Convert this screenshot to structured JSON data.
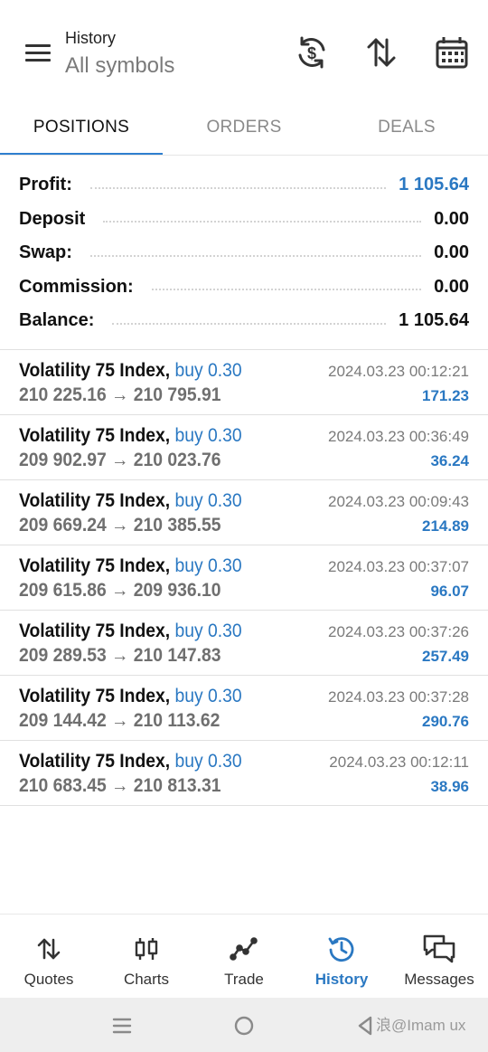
{
  "header": {
    "title": "History",
    "subtitle": "All symbols",
    "icons": [
      "currency-exchange-icon",
      "sort-arrows-icon",
      "calendar-icon"
    ]
  },
  "tabs": [
    {
      "label": "POSITIONS",
      "active": true
    },
    {
      "label": "ORDERS",
      "active": false
    },
    {
      "label": "DEALS",
      "active": false
    }
  ],
  "summary": [
    {
      "label": "Profit:",
      "value": "1 105.64",
      "highlight": true
    },
    {
      "label": "Deposit",
      "value": "0.00",
      "highlight": false
    },
    {
      "label": "Swap:",
      "value": "0.00",
      "highlight": false
    },
    {
      "label": "Commission:",
      "value": "0.00",
      "highlight": false
    },
    {
      "label": "Balance:",
      "value": "1 105.64",
      "highlight": false
    }
  ],
  "deals": [
    {
      "symbol": "Volatility 75 Index,",
      "side": "buy 0.30",
      "prices": "210 225.16 → 210 795.91",
      "time": "2024.03.23 00:12:21",
      "profit": "171.23"
    },
    {
      "symbol": "Volatility 75 Index,",
      "side": "buy 0.30",
      "prices": "209 902.97 → 210 023.76",
      "time": "2024.03.23 00:36:49",
      "profit": "36.24"
    },
    {
      "symbol": "Volatility 75 Index,",
      "side": "buy 0.30",
      "prices": "209 669.24 → 210 385.55",
      "time": "2024.03.23 00:09:43",
      "profit": "214.89"
    },
    {
      "symbol": "Volatility 75 Index,",
      "side": "buy 0.30",
      "prices": "209 615.86 → 209 936.10",
      "time": "2024.03.23 00:37:07",
      "profit": "96.07"
    },
    {
      "symbol": "Volatility 75 Index,",
      "side": "buy 0.30",
      "prices": "209 289.53 → 210 147.83",
      "time": "2024.03.23 00:37:26",
      "profit": "257.49"
    },
    {
      "symbol": "Volatility 75 Index,",
      "side": "buy 0.30",
      "prices": "209 144.42 → 210 113.62",
      "time": "2024.03.23 00:37:28",
      "profit": "290.76"
    },
    {
      "symbol": "Volatility 75 Index,",
      "side": "buy 0.30",
      "prices": "210 683.45 → 210 813.31",
      "time": "2024.03.23 00:12:11",
      "profit": "38.96"
    }
  ],
  "bottom_nav": [
    {
      "label": "Quotes",
      "icon": "quotes-icon",
      "active": false
    },
    {
      "label": "Charts",
      "icon": "charts-icon",
      "active": false
    },
    {
      "label": "Trade",
      "icon": "trade-icon",
      "active": false
    },
    {
      "label": "History",
      "icon": "history-icon",
      "active": true
    },
    {
      "label": "Messages",
      "icon": "messages-icon",
      "active": false
    }
  ],
  "watermark": "浪@Imam ux",
  "colors": {
    "accent": "#2a78c2",
    "tab_indicator": "#2f7fcf",
    "text": "#111111",
    "muted": "#7a7a7a"
  }
}
